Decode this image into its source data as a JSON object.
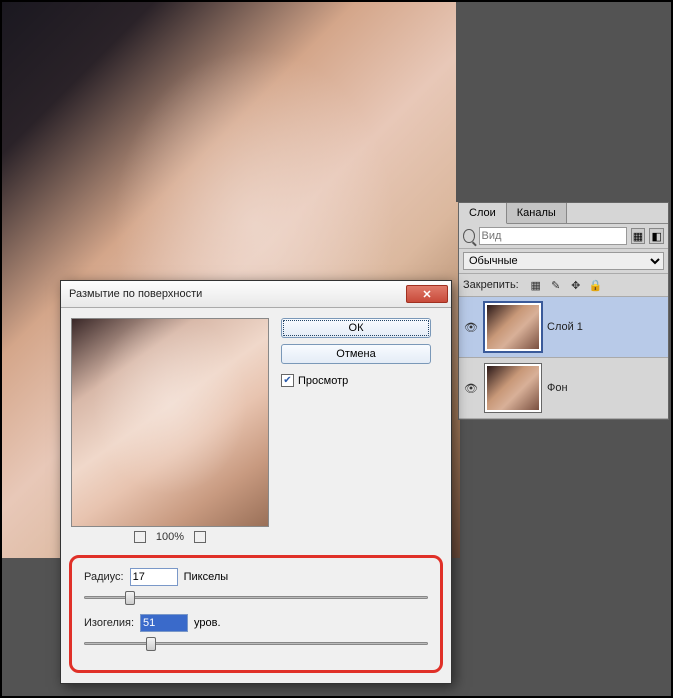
{
  "panel": {
    "tabs": {
      "layers": "Слои",
      "channels": "Каналы"
    },
    "search_placeholder": "Вид",
    "blend_mode": "Обычные",
    "lock_label": "Закрепить:"
  },
  "layers": [
    {
      "name": "Слой 1"
    },
    {
      "name": "Фон"
    }
  ],
  "dialog": {
    "title": "Размытие по поверхности",
    "ok": "ОК",
    "cancel": "Отмена",
    "preview_label": "Просмотр",
    "zoom": "100%",
    "radius_label": "Радиус:",
    "radius_value": "17",
    "radius_unit": "Пикселы",
    "threshold_label": "Изогелия:",
    "threshold_value": "51",
    "threshold_unit": "уров."
  }
}
